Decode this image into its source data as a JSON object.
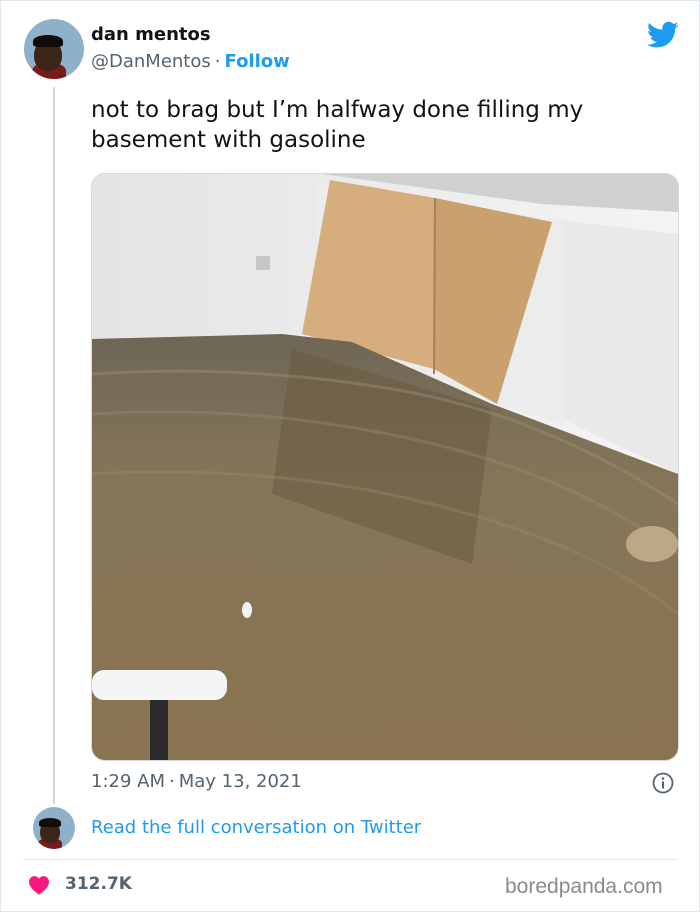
{
  "tweet": {
    "author_name": "dan mentos",
    "author_handle": "@DanMentos",
    "separator": "·",
    "follow_label": "Follow",
    "text": "not to brag but I’m halfway done filling my basement with gasoline",
    "time": "1:29 AM",
    "date": "May 13, 2021",
    "read_conversation_label": "Read the full conversation on Twitter",
    "like_count": "312.7K"
  },
  "icons": {
    "brand": "twitter-bird-icon",
    "info": "info-icon",
    "like": "heart-icon"
  },
  "colors": {
    "link_blue": "#1d9bf0",
    "heart_pink": "#f91880",
    "secondary_text": "#536471"
  },
  "watermark": "boredpanda.com"
}
